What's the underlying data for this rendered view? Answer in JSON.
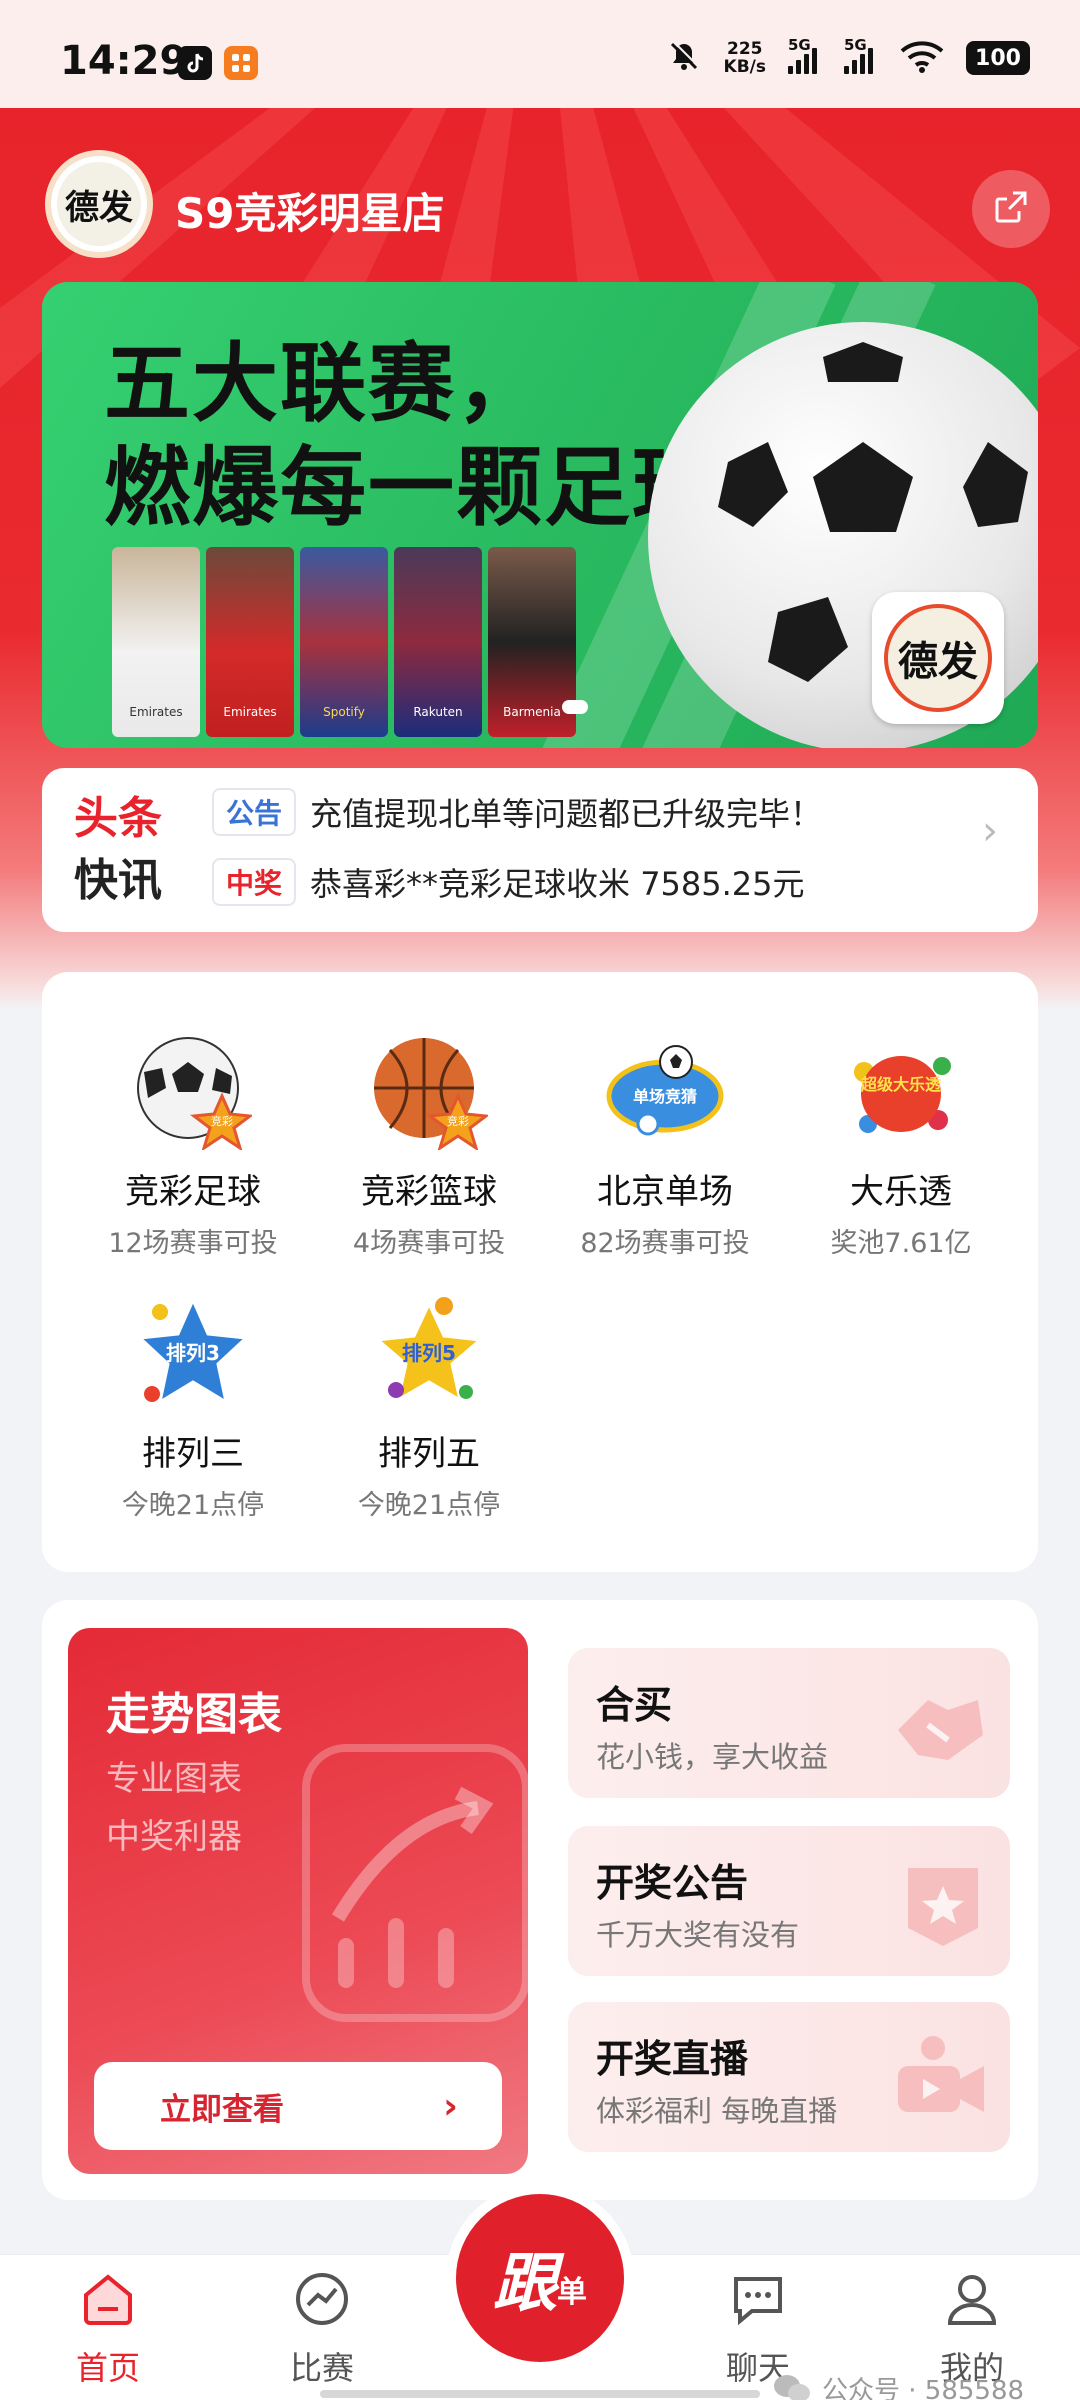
{
  "status_bar": {
    "time": "14:29",
    "net_speed_value": "225",
    "net_speed_unit": "KB/s",
    "signal1_label": "5G",
    "signal2_label": "5G",
    "battery": "100"
  },
  "header": {
    "store_name": "S9竞彩明星店",
    "logo_text": "德发"
  },
  "banner": {
    "title_line1": "五大联赛，",
    "title_line2": "燃爆每一颗足球心！",
    "logo_text": "德发",
    "jersey_text_1": "Emirates",
    "jersey_text_2": "Emirates",
    "jersey_text_3": "Spotify",
    "jersey_text_4": "Rakuten",
    "jersey_text_5": "Barmenia"
  },
  "news": {
    "logo_line1": "头条",
    "logo_line2": "快讯",
    "items": [
      {
        "tag": "公告",
        "text": "充值提现北单等问题都已升级完毕！"
      },
      {
        "tag": "中奖",
        "text": "恭喜彩**竞彩足球收米 7585.25元"
      }
    ]
  },
  "lotteries": [
    {
      "name": "竞彩足球",
      "sub": "12场赛事可投",
      "icon": "soccer-ball-icon",
      "badge": "竞彩"
    },
    {
      "name": "竞彩篮球",
      "sub": "4场赛事可投",
      "icon": "basketball-icon",
      "badge": "竞彩"
    },
    {
      "name": "北京单场",
      "sub": "82场赛事可投",
      "icon": "beijing-single-icon",
      "badge": "单场竞猜"
    },
    {
      "name": "大乐透",
      "sub": "奖池7.61亿",
      "icon": "dalet-icon",
      "badge": "超级大乐透"
    },
    {
      "name": "排列三",
      "sub": "今晚21点停",
      "icon": "pailie3-icon",
      "badge": "排列3"
    },
    {
      "name": "排列五",
      "sub": "今晚21点停",
      "icon": "pailie5-icon",
      "badge": "排列5"
    }
  ],
  "features": {
    "trend": {
      "title": "走势图表",
      "sub1": "专业图表",
      "sub2": "中奖利器",
      "button": "立即查看"
    },
    "cards": [
      {
        "title": "合买",
        "sub": "花小钱，享大收益"
      },
      {
        "title": "开奖公告",
        "sub": "千万大奖有没有"
      },
      {
        "title": "开奖直播",
        "sub": "体彩福利 每晚直播"
      }
    ]
  },
  "bottom_nav": {
    "home": "首页",
    "match": "比赛",
    "fab_main": "跟",
    "fab_sub": "单",
    "chat": "聊天",
    "mine": "我的"
  },
  "watermark": "公众号 · 585588",
  "colors": {
    "primary_red": "#e8232b",
    "banner_green": "#2ec66a",
    "tag_blue": "#3a73d6"
  }
}
